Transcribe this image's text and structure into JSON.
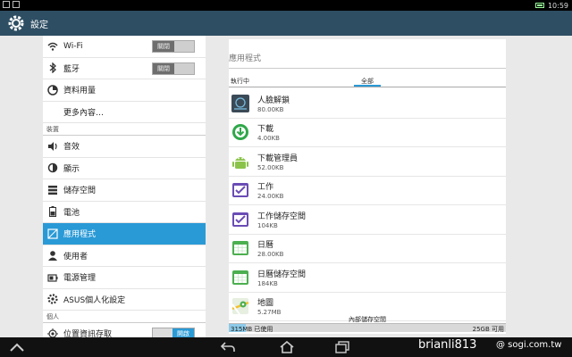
{
  "status_bar": {
    "time": "10:59"
  },
  "action_bar": {
    "title": "設定"
  },
  "sidebar": {
    "items_top": [
      {
        "label": "Wi-Fi",
        "icon": "wifi-icon",
        "toggle": "關閉"
      },
      {
        "label": "藍牙",
        "icon": "bluetooth-icon",
        "toggle": "關閉"
      },
      {
        "label": "資料用量",
        "icon": "data-usage-icon"
      },
      {
        "label": "更多內容…",
        "icon": ""
      }
    ],
    "section_device": "裝置",
    "items_device": [
      {
        "label": "音效",
        "icon": "speaker-icon"
      },
      {
        "label": "顯示",
        "icon": "brightness-icon"
      },
      {
        "label": "儲存空間",
        "icon": "storage-icon"
      },
      {
        "label": "電池",
        "icon": "battery-icon"
      },
      {
        "label": "應用程式",
        "icon": "apps-icon",
        "selected": true
      },
      {
        "label": "使用者",
        "icon": "user-icon"
      },
      {
        "label": "電源管理",
        "icon": "power-management-icon"
      },
      {
        "label": "ASUS個人化設定",
        "icon": "gear-icon"
      }
    ],
    "section_personal": "個人",
    "items_personal": [
      {
        "label": "位置資訊存取",
        "icon": "location-icon",
        "toggle": "開啟"
      }
    ]
  },
  "main": {
    "section_title": "應用程式",
    "tab_running": "執行中",
    "tab_all": "全部",
    "apps": [
      {
        "name": "人臉解鎖",
        "size": "80.00KB",
        "icon": "face-unlock-icon"
      },
      {
        "name": "下載",
        "size": "4.00KB",
        "icon": "download-icon"
      },
      {
        "name": "下載管理員",
        "size": "52.00KB",
        "icon": "android-icon"
      },
      {
        "name": "工作",
        "size": "24.00KB",
        "icon": "task-icon"
      },
      {
        "name": "工作儲存空間",
        "size": "104KB",
        "icon": "task-storage-icon"
      },
      {
        "name": "日曆",
        "size": "28.00KB",
        "icon": "calendar-icon"
      },
      {
        "name": "日曆儲存空間",
        "size": "184KB",
        "icon": "calendar-storage-icon"
      },
      {
        "name": "地圖",
        "size": "5.27MB",
        "icon": "maps-icon"
      }
    ],
    "storage": {
      "label": "內部儲存空間",
      "used": "315MB 已使用",
      "free": "25GB 可用",
      "used_fraction": 0.012
    }
  },
  "watermark": {
    "user": "brianli813",
    "site": "@ sogi.com.tw"
  },
  "colors": {
    "accent": "#2a9ad6",
    "actionbar": "#2e4e63"
  }
}
